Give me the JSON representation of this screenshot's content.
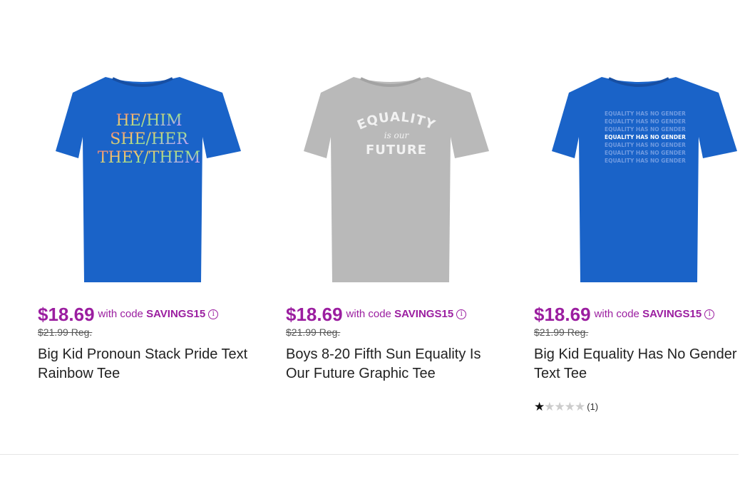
{
  "products": [
    {
      "price": "$18.69",
      "promo_prefix": "with code",
      "promo_code": "SAVINGS15",
      "reg_price": "$21.99 Reg.",
      "title": "Big Kid Pronoun Stack Pride Text Rainbow Tee",
      "shirt_color": "#1a63c8",
      "shirt_print": [
        "HE/HIM",
        "SHE/HER",
        "THEY/THEM"
      ]
    },
    {
      "price": "$18.69",
      "promo_prefix": "with code",
      "promo_code": "SAVINGS15",
      "reg_price": "$21.99 Reg.",
      "title": "Boys 8-20 Fifth Sun Equality Is Our Future Graphic Tee",
      "shirt_color": "#b9b9b9",
      "shirt_print": [
        "EQUALITY",
        "is our",
        "FUTURE"
      ]
    },
    {
      "price": "$18.69",
      "promo_prefix": "with code",
      "promo_code": "SAVINGS15",
      "reg_price": "$21.99 Reg.",
      "title": "Big Kid Equality Has No Gender Text Tee",
      "shirt_color": "#1a63c8",
      "shirt_print": [
        "EQUALITY HAS NO GENDER",
        "EQUALITY HAS NO GENDER",
        "EQUALITY HAS NO GENDER",
        "EQUALITY HAS NO GENDER",
        "EQUALITY HAS NO GENDER",
        "EQUALITY HAS NO GENDER",
        "EQUALITY HAS NO GENDER"
      ],
      "rating": {
        "stars": 1,
        "out_of": 5,
        "count": "(1)"
      }
    }
  ],
  "colors": {
    "sale_price": "#9b1ea0",
    "divider": "#e6e6e6"
  },
  "icons": {
    "info": "info-circle-icon",
    "star": "star-icon"
  }
}
